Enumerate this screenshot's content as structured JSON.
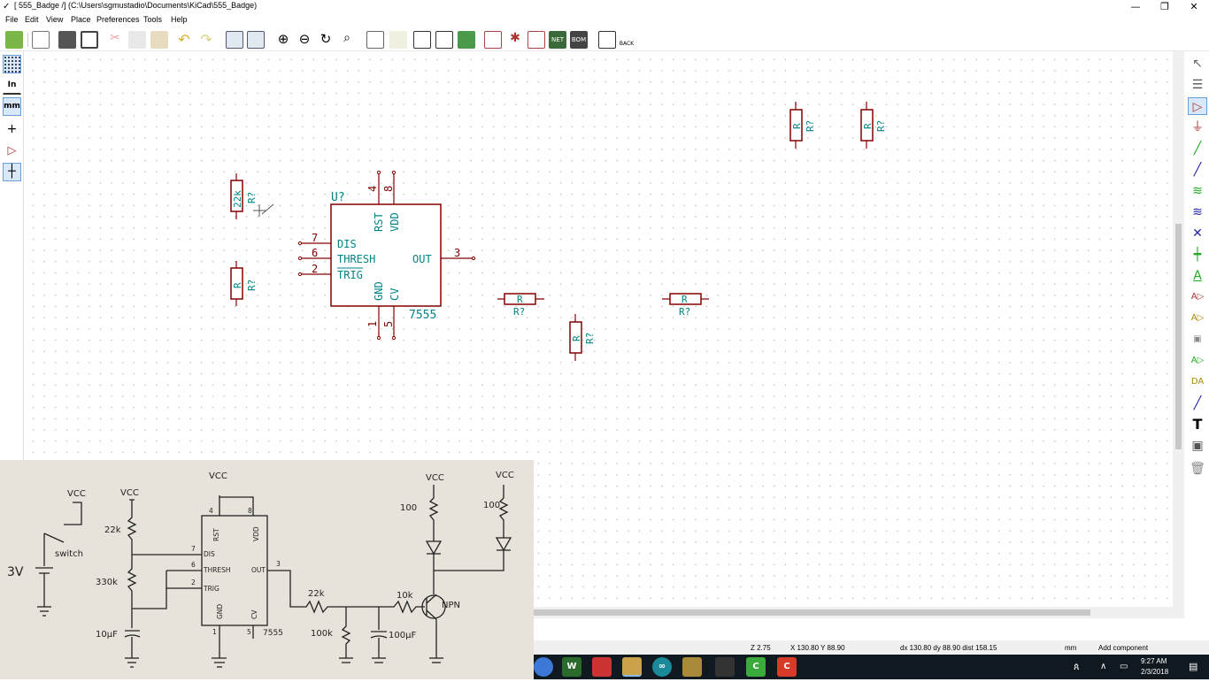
{
  "window": {
    "title": "[ 555_Badge /] (C:\\Users\\sgmustadio\\Documents\\KiCad\\555_Badge)",
    "minimize": "—",
    "maximize": "❐",
    "close": "✕"
  },
  "menu": [
    "File",
    "Edit",
    "View",
    "Place",
    "Preferences",
    "Tools",
    "Help"
  ],
  "left_toolbar": {
    "units_in": "In",
    "units_mm": "mm"
  },
  "schematic": {
    "ic": {
      "reference": "U?",
      "value": "7555",
      "pins_left": [
        {
          "num": "7",
          "name": "DIS"
        },
        {
          "num": "6",
          "name": "THRESH"
        },
        {
          "num": "2",
          "name": "TRIG"
        }
      ],
      "pin_right": {
        "num": "3",
        "name": "OUT"
      },
      "pins_top": [
        {
          "num": "4",
          "name": "RST"
        },
        {
          "num": "8",
          "name": "VDD"
        }
      ],
      "pins_bottom": [
        {
          "num": "1",
          "name": "GND"
        },
        {
          "num": "5",
          "name": "CV"
        }
      ]
    },
    "resistors": [
      {
        "value": "22k",
        "ref": "R?"
      },
      {
        "value": "R",
        "ref": "R?"
      },
      {
        "value": "R",
        "ref": "R?"
      },
      {
        "value": "R",
        "ref": "R?"
      },
      {
        "value": "R",
        "ref": "R?"
      },
      {
        "value": "R",
        "ref": "R?"
      },
      {
        "value": "R",
        "ref": "R?"
      }
    ]
  },
  "statusbar": {
    "zoom": "Z 2.75",
    "cursor": "X 130.80  Y 88.90",
    "delta": "dx 130.80  dy 88.90  dist 158.15",
    "units": "mm",
    "mode": "Add component"
  },
  "taskbar": {
    "time": "9:27 AM",
    "date": "2/3/2018"
  },
  "sketch": {
    "labels": {
      "vcc": "VCC",
      "battery": "3V",
      "switch": "switch",
      "r1": "22k",
      "r2": "330k",
      "cap1": "10μF",
      "ic": "7555",
      "r_out": "22k",
      "r_base": "10k",
      "r_pull": "100k",
      "cap2": "100μF",
      "r_led1": "100",
      "r_led2": "100",
      "transistor": "NPN"
    },
    "ic_pins": {
      "rst": "RST",
      "vdd": "VDD",
      "dis": "DIS",
      "thresh": "THRESH",
      "trig": "TRIG",
      "out": "OUT",
      "gnd": "GND",
      "cv": "CV",
      "p4": "4",
      "p8": "8",
      "p7": "7",
      "p6": "6",
      "p2": "2",
      "p3": "3",
      "p1": "1",
      "p5": "5"
    },
    "colors": {
      "paper": "#e8e3da",
      "ink": "#222222"
    }
  },
  "colors": {
    "schematic_body": "#840000",
    "schematic_text": "#008484",
    "pin_text": "#840000",
    "grid_dot": "#b8b8b8",
    "taskbar": "#101820"
  }
}
